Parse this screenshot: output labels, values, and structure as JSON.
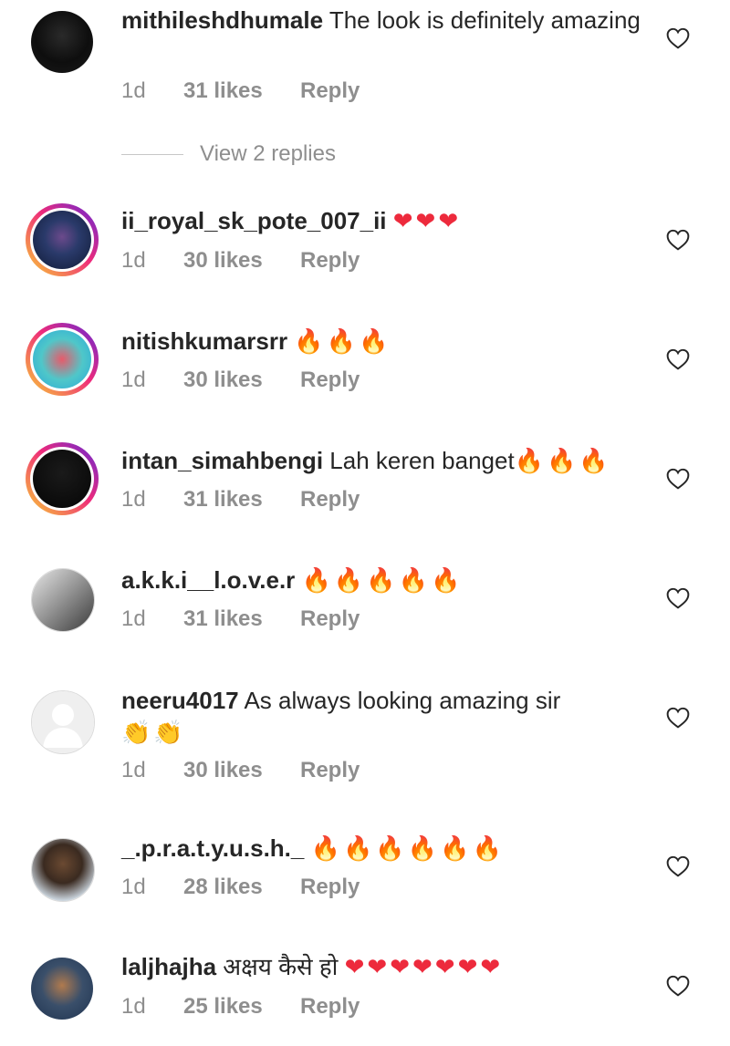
{
  "colors": {
    "text": "#262626",
    "muted": "#8e8e8e",
    "story_ring": "#ee2a7b"
  },
  "view_replies": "View 2 replies",
  "comments": [
    {
      "username": "mithileshdhumale",
      "text": "The look is definitely amazing",
      "emoji": "",
      "time": "1d",
      "likes": "31 likes",
      "reply": "Reply"
    },
    {
      "username": "ii_royal_sk_pote_007_ii",
      "text": "",
      "emoji": "❤❤❤",
      "time": "1d",
      "likes": "30 likes",
      "reply": "Reply"
    },
    {
      "username": "nitishkumarsrr",
      "text": "",
      "emoji": "🔥🔥🔥",
      "time": "1d",
      "likes": "30 likes",
      "reply": "Reply"
    },
    {
      "username": "intan_simahbengi",
      "text": "Lah keren banget",
      "emoji": "🔥🔥🔥",
      "time": "1d",
      "likes": "31 likes",
      "reply": "Reply"
    },
    {
      "username": "a.k.k.i__l.o.v.e.r",
      "text": "",
      "emoji": "🔥🔥🔥🔥🔥",
      "time": "1d",
      "likes": "31 likes",
      "reply": "Reply"
    },
    {
      "username": "neeru4017",
      "text": "As always looking amazing sir",
      "emoji": "👏👏",
      "time": "1d",
      "likes": "30 likes",
      "reply": "Reply"
    },
    {
      "username": "_.p.r.a.t.y.u.s.h._",
      "text": "",
      "emoji": "🔥🔥🔥🔥🔥🔥",
      "time": "1d",
      "likes": "28 likes",
      "reply": "Reply"
    },
    {
      "username": "laljhajha",
      "text": "अक्षय कैसे हो",
      "emoji": "❤❤❤❤❤❤❤",
      "time": "1d",
      "likes": "25 likes",
      "reply": "Reply"
    }
  ]
}
